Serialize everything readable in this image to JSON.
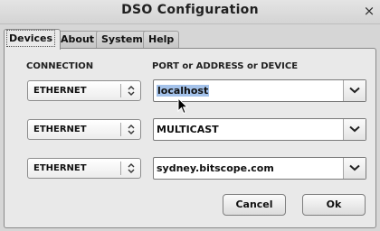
{
  "window": {
    "title": "DSO Configuration",
    "close_glyph": "×"
  },
  "tabs": [
    {
      "label": "Devices",
      "active": true
    },
    {
      "label": "About",
      "active": false
    },
    {
      "label": "System",
      "active": false
    },
    {
      "label": "Help",
      "active": false
    }
  ],
  "columns": {
    "connection": "CONNECTION",
    "port": "PORT or ADDRESS or DEVICE"
  },
  "rows": [
    {
      "connection": "ETHERNET",
      "address": "localhost",
      "address_selected": true
    },
    {
      "connection": "ETHERNET",
      "address": "MULTICAST",
      "address_selected": false
    },
    {
      "connection": "ETHERNET",
      "address": "sydney.bitscope.com",
      "address_selected": false
    }
  ],
  "buttons": {
    "cancel": "Cancel",
    "ok": "Ok"
  },
  "icons": {
    "close": "close-icon",
    "updown": "updown-arrows-icon",
    "dropdown": "chevron-down-icon",
    "cursor": "mouse-pointer-icon"
  },
  "colors": {
    "selection": "#a4c2ea",
    "background": "#d6d6d6"
  }
}
